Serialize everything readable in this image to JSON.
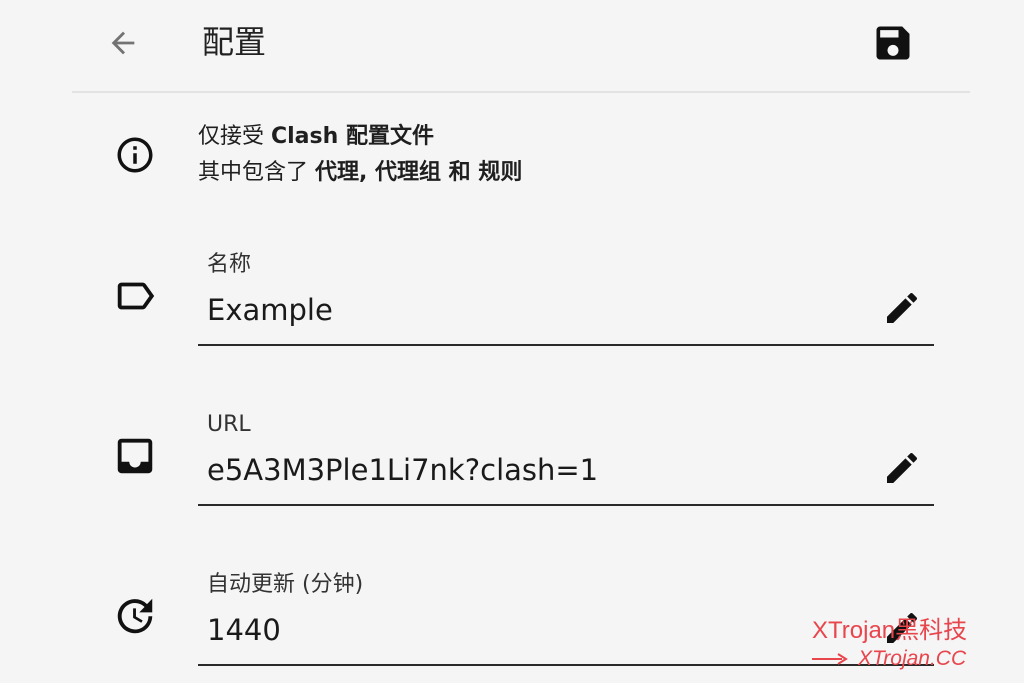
{
  "header": {
    "title": "配置",
    "back_icon": "arrow-back-icon",
    "save_icon": "save-floppy-icon"
  },
  "info": {
    "line1_prefix": "仅接受 ",
    "line1_bold": "Clash 配置文件",
    "line2_prefix": "其中包含了 ",
    "line2_bold": "代理, 代理组 和 规则",
    "icon": "info-icon"
  },
  "fields": {
    "name": {
      "label": "名称",
      "value": "Example",
      "icon": "label-tag-icon"
    },
    "url": {
      "label": "URL",
      "value": "e5A3M3Ple1Li7nk?clash=1",
      "icon": "inbox-icon"
    },
    "update": {
      "label": "自动更新 (分钟)",
      "value": "1440",
      "icon": "update-clock-icon"
    }
  },
  "watermark": {
    "line1": "XTrojan黑科技",
    "line2": "XTrojan.CC"
  },
  "colors": {
    "background": "#f5f5f5",
    "icon": "#111111",
    "watermark": "#e8454d"
  }
}
